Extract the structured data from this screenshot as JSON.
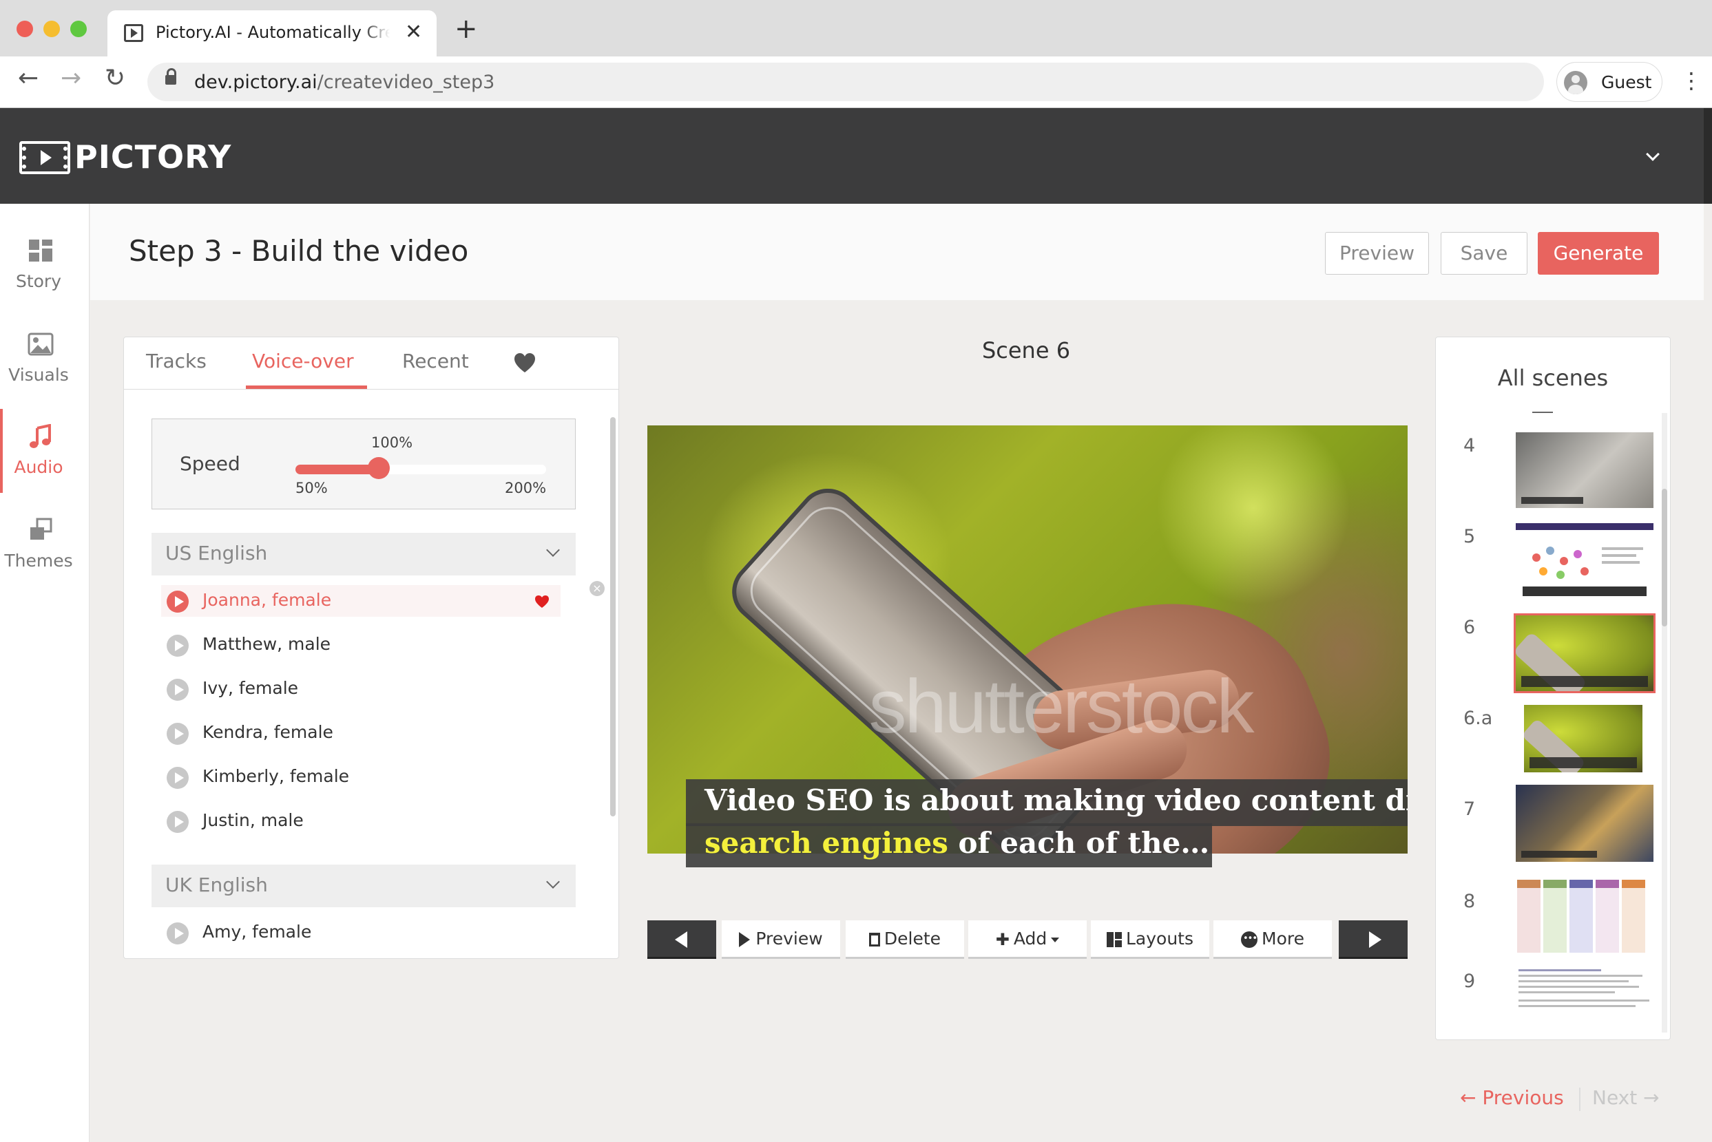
{
  "browser": {
    "tab_title": "Pictory.AI - Automatically Create",
    "tab_close": "✕",
    "new_tab": "+",
    "url_domain": "dev.pictory.ai",
    "url_path": "/createvideo_step3",
    "profile_label": "Guest",
    "back_glyph": "←",
    "forward_glyph": "→",
    "reload_glyph": "↻",
    "menu_glyph": "⋮"
  },
  "app": {
    "logo_text": "PICTORY"
  },
  "sidebar": {
    "items": [
      {
        "label": "Story",
        "icon": "dashboard-icon"
      },
      {
        "label": "Visuals",
        "icon": "image-icon"
      },
      {
        "label": "Audio",
        "icon": "music-note-icon",
        "active": true
      },
      {
        "label": "Themes",
        "icon": "layers-icon"
      }
    ]
  },
  "step": {
    "title": "Step 3 - Build the video",
    "preview_label": "Preview",
    "save_label": "Save",
    "generate_label": "Generate"
  },
  "audio_panel": {
    "tabs": [
      "Tracks",
      "Voice-over",
      "Recent"
    ],
    "active_tab": "Voice-over",
    "speed": {
      "label": "Speed",
      "value_label": "100%",
      "min_label": "50%",
      "max_label": "200%",
      "value": 100,
      "min": 50,
      "max": 200
    },
    "us_english": {
      "label": "US English",
      "voices": [
        {
          "name": "Joanna, female",
          "selected": true,
          "favorite": true
        },
        {
          "name": "Matthew, male"
        },
        {
          "name": "Ivy, female"
        },
        {
          "name": "Kendra, female"
        },
        {
          "name": "Kimberly, female"
        },
        {
          "name": "Justin, male"
        }
      ]
    },
    "uk_english": {
      "label": "UK English",
      "voices": [
        {
          "name": "Amy, female"
        }
      ]
    }
  },
  "scene": {
    "title": "Scene 6",
    "watermark": "shutterstock",
    "caption_line1": "Video SEO is about making video content discoverable in the",
    "caption_line2_highlight": "search engines",
    "caption_line2_rest": " of each of the…",
    "controls": {
      "preview": "Preview",
      "delete": "Delete",
      "add": "Add",
      "layouts": "Layouts",
      "more": "More"
    }
  },
  "all_scenes": {
    "title": "All scenes",
    "items": [
      {
        "number": "4"
      },
      {
        "number": "5"
      },
      {
        "number": "6",
        "selected": true
      },
      {
        "number": "6.a"
      },
      {
        "number": "7"
      },
      {
        "number": "8"
      },
      {
        "number": "9"
      }
    ]
  },
  "footer": {
    "previous": "← Previous",
    "next": "Next →"
  },
  "colors": {
    "accent": "#e8645f",
    "header_bg": "#3c3c3d",
    "caption_highlight": "#f4f03c"
  }
}
